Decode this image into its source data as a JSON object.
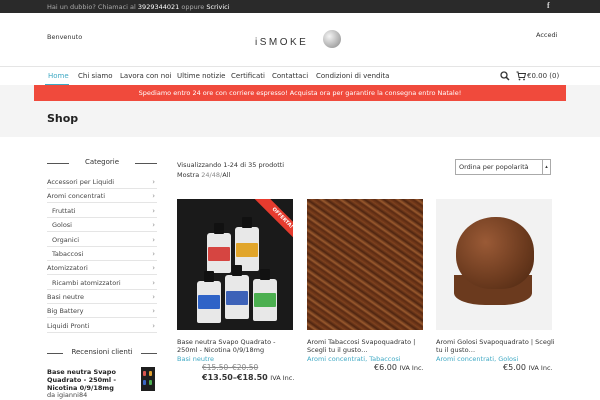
{
  "topbar": {
    "text_before": "Hai un dubbio? Chiamaci al",
    "phone": "3929344021",
    "text_between": "oppure",
    "write_link": "Scrivici",
    "social_icon": "f"
  },
  "header": {
    "welcome": "Benvenuto",
    "logo_text": "iSMOKE",
    "login": "Accedi"
  },
  "nav": {
    "items": [
      "Home",
      "Chi siamo",
      "Lavora con noi",
      "Ultime notizie",
      "Certificati",
      "Contattaci",
      "Condizioni di vendita"
    ],
    "cart_total": "€0.00 (0)"
  },
  "banner": "Spediamo entro 24 ore con corriere espresso! Acquista ora per garantire la consegna entro Natale!",
  "page_title": "Shop",
  "sidebar": {
    "categories_title": "Categorie",
    "categories": [
      {
        "label": "Accessori per Liquidi",
        "sub": false
      },
      {
        "label": "Aromi concentrati",
        "sub": false
      },
      {
        "label": "Fruttati",
        "sub": true
      },
      {
        "label": "Golosi",
        "sub": true
      },
      {
        "label": "Organici",
        "sub": true
      },
      {
        "label": "Tabaccosi",
        "sub": true
      },
      {
        "label": "Atomizzatori",
        "sub": false
      },
      {
        "label": "Ricambi atomizzatori",
        "sub": true
      },
      {
        "label": "Basi neutre",
        "sub": false
      },
      {
        "label": "Big Battery",
        "sub": false
      },
      {
        "label": "Liquidi Pronti",
        "sub": false
      }
    ],
    "reviews_title": "Recensioni clienti",
    "review": {
      "title": "Base neutra Svapo Quadrato - 250ml - Nicotina 0/9/18mg",
      "by": "da igianni84"
    }
  },
  "shop": {
    "result_count": "Visualizzando 1-24 di 35 prodotti",
    "show_label": "Mostra",
    "show_options": [
      "24",
      "48",
      "All"
    ],
    "sort_selected": "Ordina per popolarità",
    "products": [
      {
        "name": "Base neutra Svapo Quadrato - 250ml - Nicotina 0/9/18mg",
        "category": "Basi neutre",
        "old_price": "€15.50–€20.50",
        "price": "€13.50–€18.50",
        "vat": "IVA Inc.",
        "badge": "OFFERTA!"
      },
      {
        "name": "Aromi Tabaccosi Svapoquadrato | Scegli tu il gusto…",
        "category": "Aromi concentrati, Tabaccosi",
        "price": "€6.00",
        "vat": "IVA Inc."
      },
      {
        "name": "Aromi Golosi Svapoquadrato | Scegli tu il gusto…",
        "category": "Aromi concentrati, Golosi",
        "price": "€5.00",
        "vat": "IVA Inc."
      }
    ]
  },
  "colors": {
    "accent": "#3fa9c4",
    "banner": "#f04a3c",
    "topbar": "#2a2a2a"
  }
}
